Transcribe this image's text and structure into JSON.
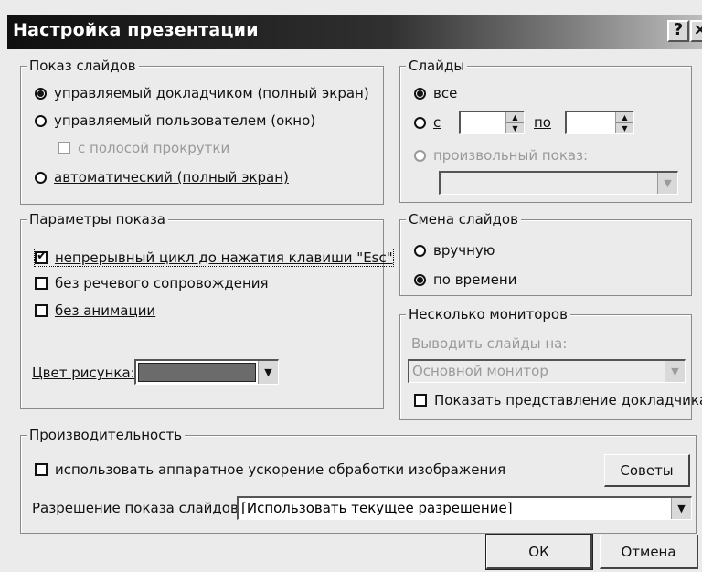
{
  "window": {
    "title": "Настройка презентации",
    "help_label": "?",
    "close_label": "×"
  },
  "show_type": {
    "legend": "Показ слайдов",
    "speaker": "управляемый докладчиком (полный экран)",
    "user": "управляемый пользователем (окно)",
    "scrollbar": "с полосой прокрутки",
    "kiosk": "автоматический (полный экран)",
    "selected": "speaker"
  },
  "slides": {
    "legend": "Слайды",
    "all": "все",
    "from": "с",
    "to": "по",
    "from_value": "",
    "to_value": "",
    "custom": "произвольный показ:",
    "custom_value": "",
    "selected": "all"
  },
  "options": {
    "legend": "Параметры показа",
    "loop": "непрерывный цикл до нажатия клавиши \"Esc\"",
    "loop_checked": true,
    "no_narration": "без речевого сопровождения",
    "no_animation": "без анимации",
    "pen_color_label": "Цвет рисунка:",
    "pen_color": "#6b6b6b"
  },
  "advance": {
    "legend": "Смена слайдов",
    "manual": "вручную",
    "timings": "по времени",
    "selected": "timings"
  },
  "monitors": {
    "legend": "Несколько мониторов",
    "display_on_label": "Выводить слайды на:",
    "display_on_value": "Основной монитор",
    "presenter_view": "Показать представление докладчика"
  },
  "performance": {
    "legend": "Производительность",
    "hw_accel": "использовать аппаратное ускорение обработки изображения",
    "tips_button": "Советы",
    "resolution_label": "Разрешение показа слайдов:",
    "resolution_value": "[Использовать текущее разрешение]"
  },
  "buttons": {
    "ok": "ОК",
    "cancel": "Отмена"
  }
}
